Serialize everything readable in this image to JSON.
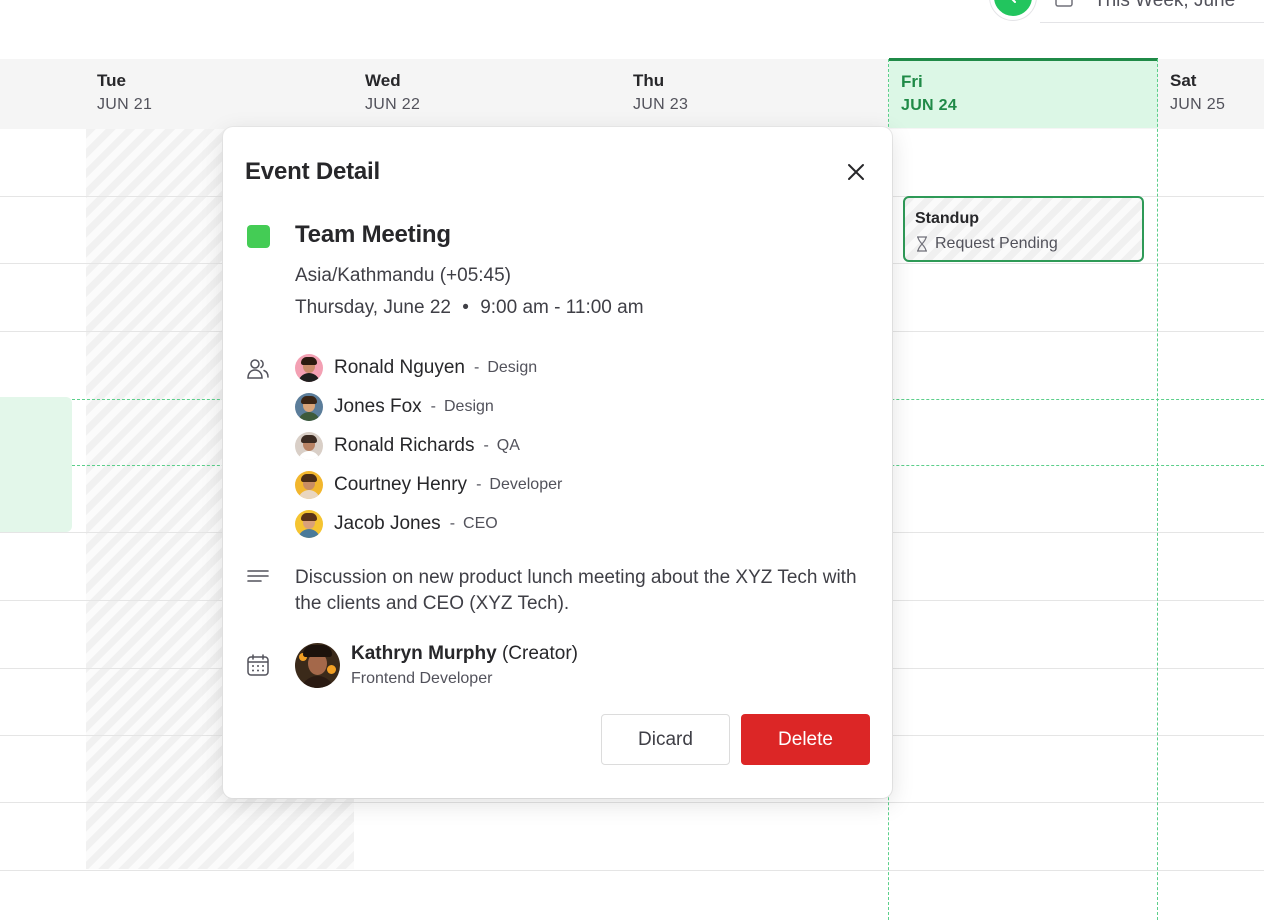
{
  "toolbar": {
    "range_label": "This Week, June",
    "accent": "#22c55e"
  },
  "week": {
    "days": [
      {
        "name": "Tue",
        "date": "JUN 21"
      },
      {
        "name": "Wed",
        "date": "JUN 22"
      },
      {
        "name": "Thu",
        "date": "JUN 23"
      },
      {
        "name": "Fri",
        "date": "JUN 24",
        "today": true
      },
      {
        "name": "Sat",
        "date": "JUN 25"
      }
    ],
    "today_color": "#1f8a47"
  },
  "calendar_event": {
    "title": "Standup",
    "status": "Request Pending",
    "status_icon": "hourglass-icon"
  },
  "modal": {
    "title": "Event Detail",
    "event_title": "Team Meeting",
    "event_color": "#44cc55",
    "timezone": "Asia/Kathmandu (+05:45)",
    "date": "Thursday, June 22",
    "time": "9:00 am - 11:00 am",
    "attendees": [
      {
        "name": "Ronald Nguyen",
        "role": "Design"
      },
      {
        "name": "Jones Fox",
        "role": "Design"
      },
      {
        "name": "Ronald Richards",
        "role": "QA"
      },
      {
        "name": "Courtney Henry",
        "role": "Developer"
      },
      {
        "name": "Jacob Jones",
        "role": "CEO"
      }
    ],
    "separator": "-",
    "description": "Discussion on new product lunch meeting about the XYZ Tech with the clients and CEO (XYZ Tech).",
    "creator": {
      "name": "Kathryn Murphy",
      "tag": "(Creator)",
      "role": "Frontend Developer"
    },
    "discard_label": "Dicard",
    "delete_label": "Delete",
    "delete_color": "#dc2626"
  }
}
